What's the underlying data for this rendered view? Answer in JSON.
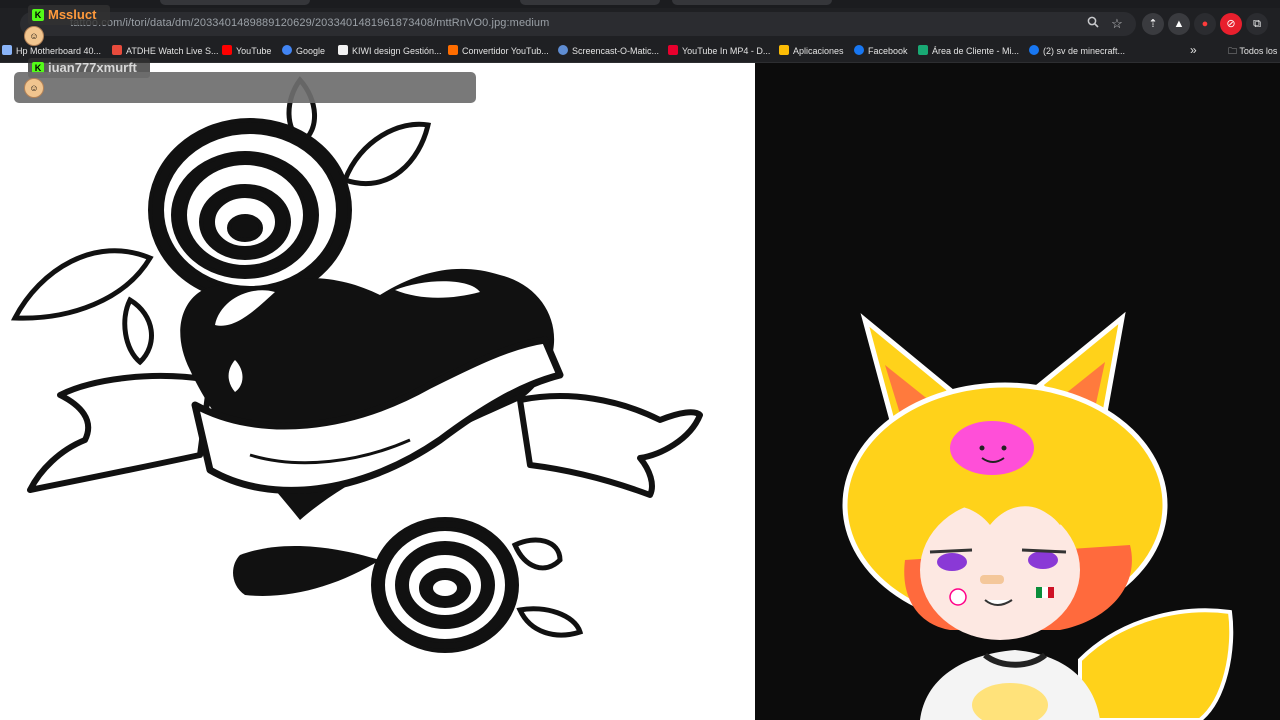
{
  "browser": {
    "url": "tattoo.com/i/tori/data/dm/2033401489889120629/2033401481961873408/mttRnVO0.jpg:medium",
    "icons": [
      "zoom-icon",
      "star-icon",
      "extension-icon",
      "download-icon",
      "record-icon",
      "screenshot-icon",
      "puzzle-icon"
    ]
  },
  "bookmarks": [
    {
      "label": "Hp Motherboard 40...",
      "color": "#8ab4f8"
    },
    {
      "label": "ATDHE Watch Live S...",
      "color": "#e84b3c"
    },
    {
      "label": "YouTube",
      "color": "#ff0000"
    },
    {
      "label": "Google",
      "color": "#4285f4"
    },
    {
      "label": "KIWI design Gestión...",
      "color": "#f2f2f2"
    },
    {
      "label": "Convertidor YouTub...",
      "color": "#ff6d00"
    },
    {
      "label": "Screencast-O-Matic...",
      "color": "#5f8dd3"
    },
    {
      "label": "YouTube In MP4 - D...",
      "color": "#e8002d"
    },
    {
      "label": "Aplicaciones",
      "color": "#fbbc05"
    },
    {
      "label": "Facebook",
      "color": "#1877f2"
    },
    {
      "label": "Área de Cliente - Mi...",
      "color": "#19a974"
    },
    {
      "label": "(2) sv de minecraft...",
      "color": "#1877f2"
    }
  ],
  "bookmarks_folder": "Todos los",
  "chat": [
    {
      "user": "Mssluct",
      "color": "#ff9a3c"
    },
    {
      "user": "juan777xmurft",
      "color": "#d8d8d8"
    }
  ],
  "badge_letter": "K",
  "colors": {
    "kick": "#53fc18",
    "hair": "#ffd21a",
    "hair_tip": "#ff6a3d",
    "pig": "#ff4fd8",
    "eye": "#8a39d6"
  }
}
